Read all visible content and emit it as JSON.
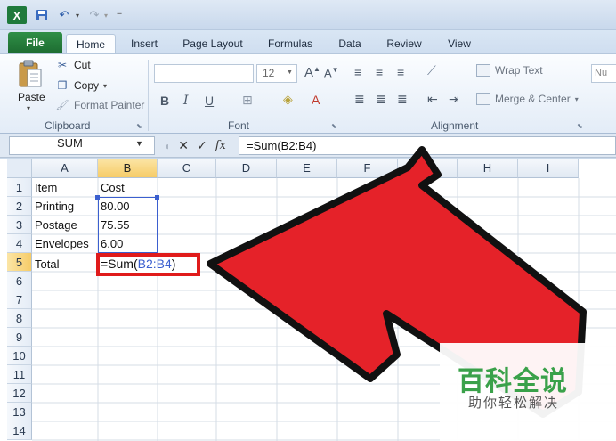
{
  "quick_access": {
    "logo_letter": "X",
    "save_icon": "save-icon",
    "undo_icon": "undo-icon",
    "redo_icon": "redo-icon",
    "dropdown_glyph": "▾",
    "customize_glyph": "⁼"
  },
  "tabs": [
    {
      "label": "File"
    },
    {
      "label": "Home"
    },
    {
      "label": "Insert"
    },
    {
      "label": "Page Layout"
    },
    {
      "label": "Formulas"
    },
    {
      "label": "Data"
    },
    {
      "label": "Review"
    },
    {
      "label": "View"
    }
  ],
  "clipboard": {
    "paste_label": "Paste",
    "cut_label": "Cut",
    "copy_label": "Copy",
    "copy_dropdown": "▾",
    "format_painter_label": "Format Painter",
    "group_label": "Clipboard"
  },
  "font": {
    "name": "",
    "size": "12",
    "group_label": "Font"
  },
  "alignment": {
    "wrap_text_label": "Wrap Text",
    "merge_center_label": "Merge & Center",
    "group_label": "Alignment"
  },
  "number": {
    "format_partial": "Nu"
  },
  "formula_bar": {
    "name_box": "SUM",
    "cancel_glyph": "✕",
    "enter_glyph": "✓",
    "fx_label": "fx",
    "formula": "=Sum(B2:B4)"
  },
  "sheet": {
    "columns": [
      "A",
      "B",
      "C",
      "D",
      "E",
      "F",
      "G",
      "H",
      "I"
    ],
    "rows": [
      "1",
      "2",
      "3",
      "4",
      "5",
      "6",
      "7",
      "8",
      "9",
      "10",
      "11",
      "12",
      "13",
      "14"
    ],
    "cells": {
      "A1": "Item",
      "B1": "Cost",
      "A2": "Printing",
      "B2": "80.00",
      "A3": "Postage",
      "B3": "75.55",
      "A4": "Envelopes",
      "B4": "6.00",
      "A5": "Total"
    },
    "active_cell": {
      "prefix": "=Sum(",
      "ref": "B2:B4",
      "suffix": ")"
    },
    "selected_column": "B",
    "selected_row": "5",
    "colors": {
      "range_border": "#3b5fcf",
      "highlight_box": "#e01b1b",
      "arrow_fill": "#e52229",
      "arrow_stroke": "#111111"
    }
  },
  "watermark": {
    "title": "百科全说",
    "subtitle": "助你轻松解决"
  }
}
